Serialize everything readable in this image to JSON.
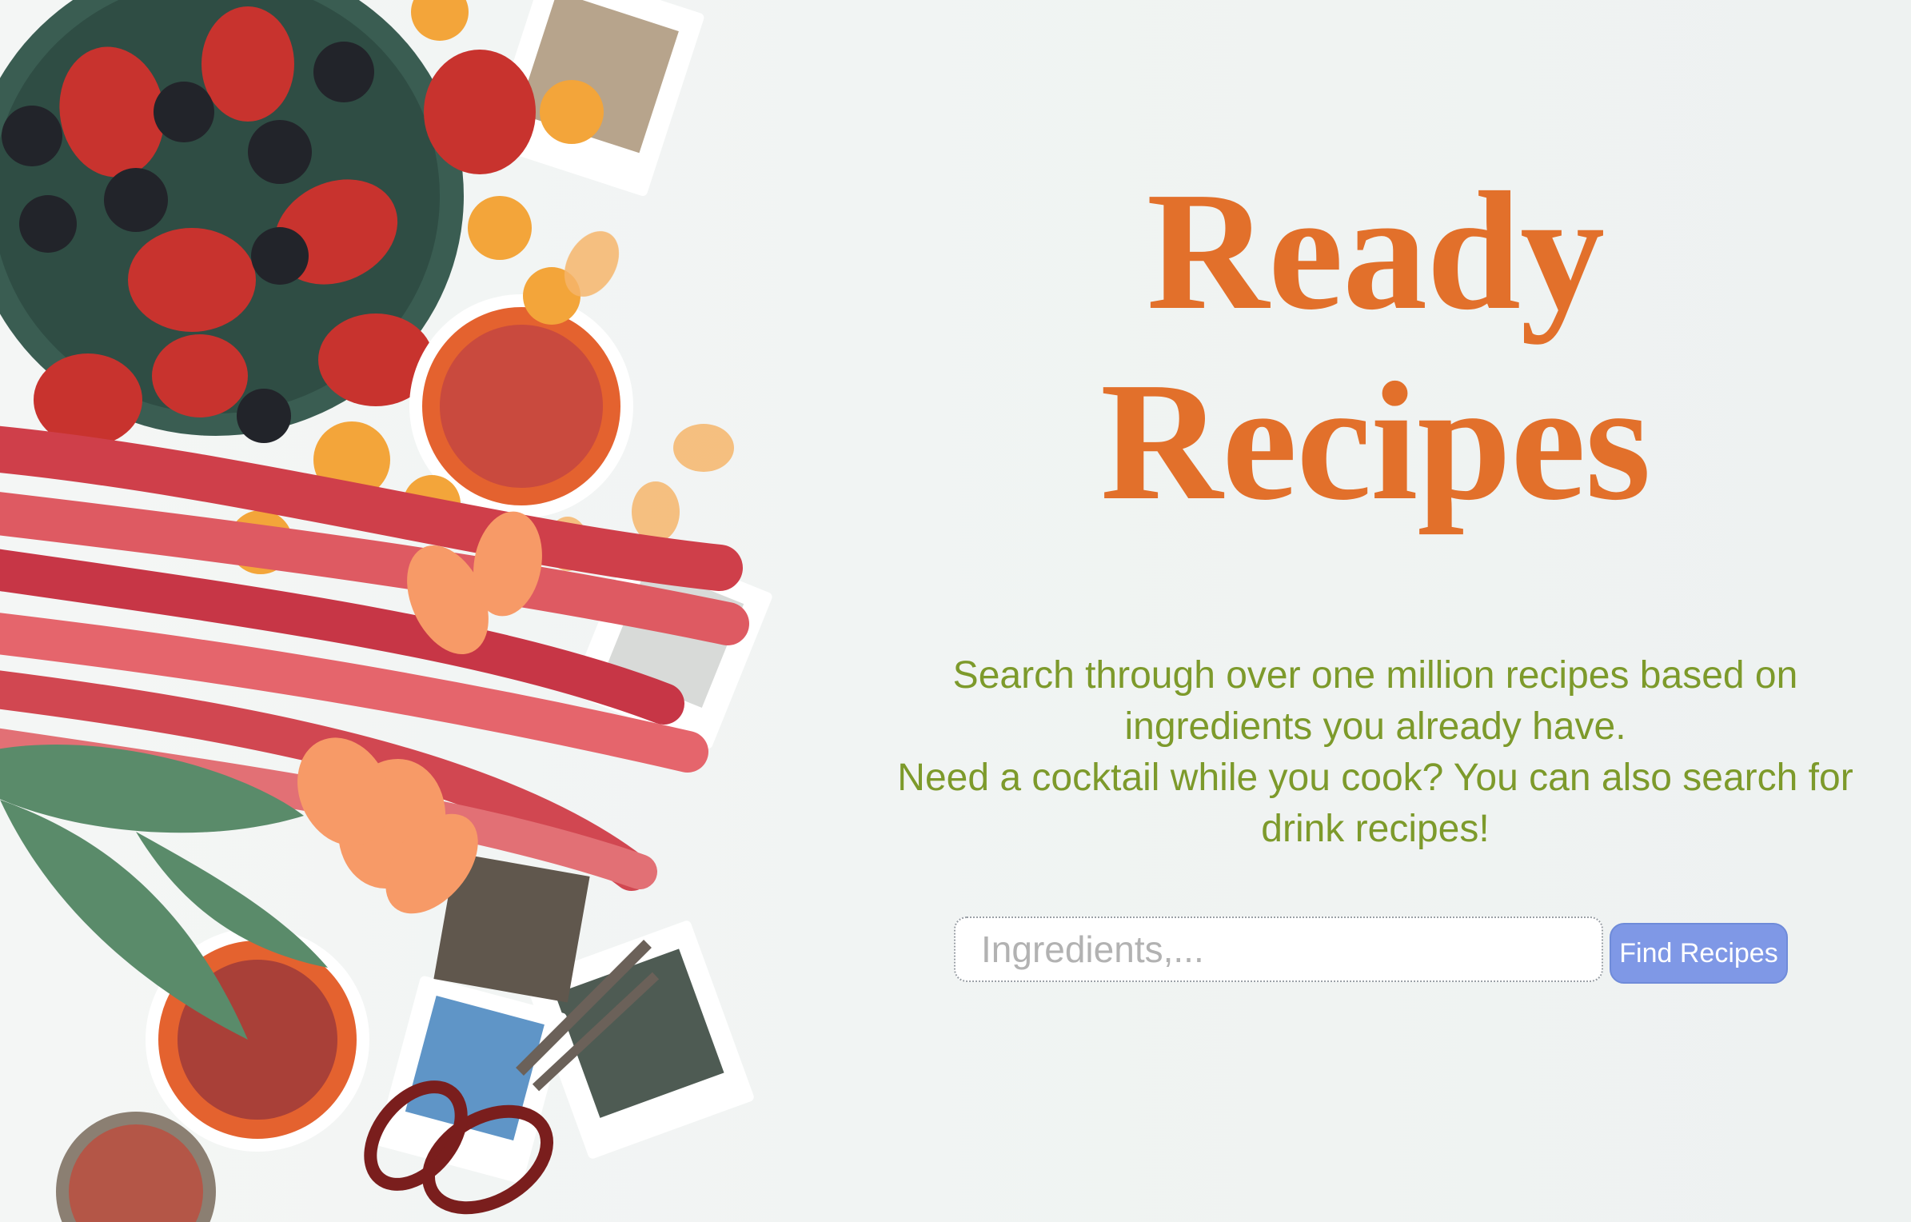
{
  "hero": {
    "title_line1": "Ready",
    "title_line2": "Recipes",
    "tagline_line1": "Search through over one million recipes based on ingredients you already have.",
    "tagline_line2": "Need a cocktail while you cook? You can also search for drink recipes!"
  },
  "search": {
    "placeholder": "Ingredients,...",
    "value": "",
    "button_label": "Find Recipes"
  },
  "colors": {
    "title": "#e2702b",
    "tagline": "#7d9a2b",
    "button": "#7f98e6",
    "background": "#f1f4f3"
  }
}
